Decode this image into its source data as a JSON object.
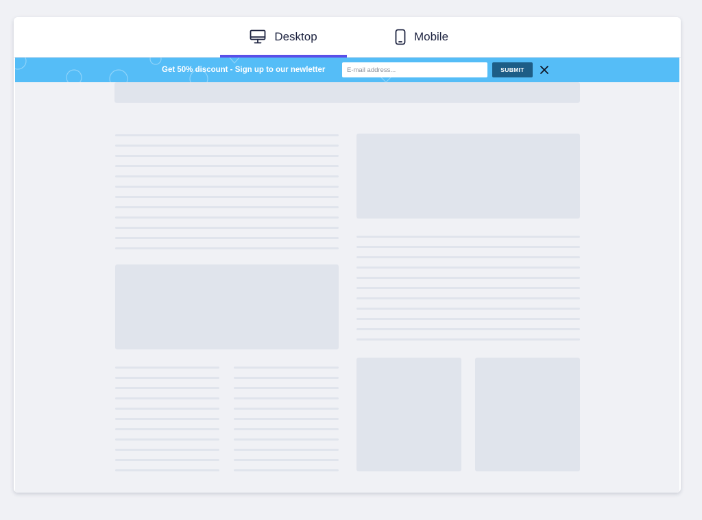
{
  "tabs": {
    "desktop": {
      "label": "Desktop",
      "icon": "monitor-icon",
      "active": true
    },
    "mobile": {
      "label": "Mobile",
      "icon": "smartphone-icon",
      "active": false
    }
  },
  "banner": {
    "text": "Get 50% discount - Sign up to our newletter",
    "email_placeholder": "E-mail address...",
    "submit_label": "SUBMIT",
    "close_icon": "close-icon"
  },
  "colors": {
    "accent": "#5a4fe8",
    "banner_bg": "#55bdf7",
    "submit_bg": "#1d5d86",
    "placeholder_block": "#e0e4ec",
    "page_bg": "#f0f1f5"
  }
}
